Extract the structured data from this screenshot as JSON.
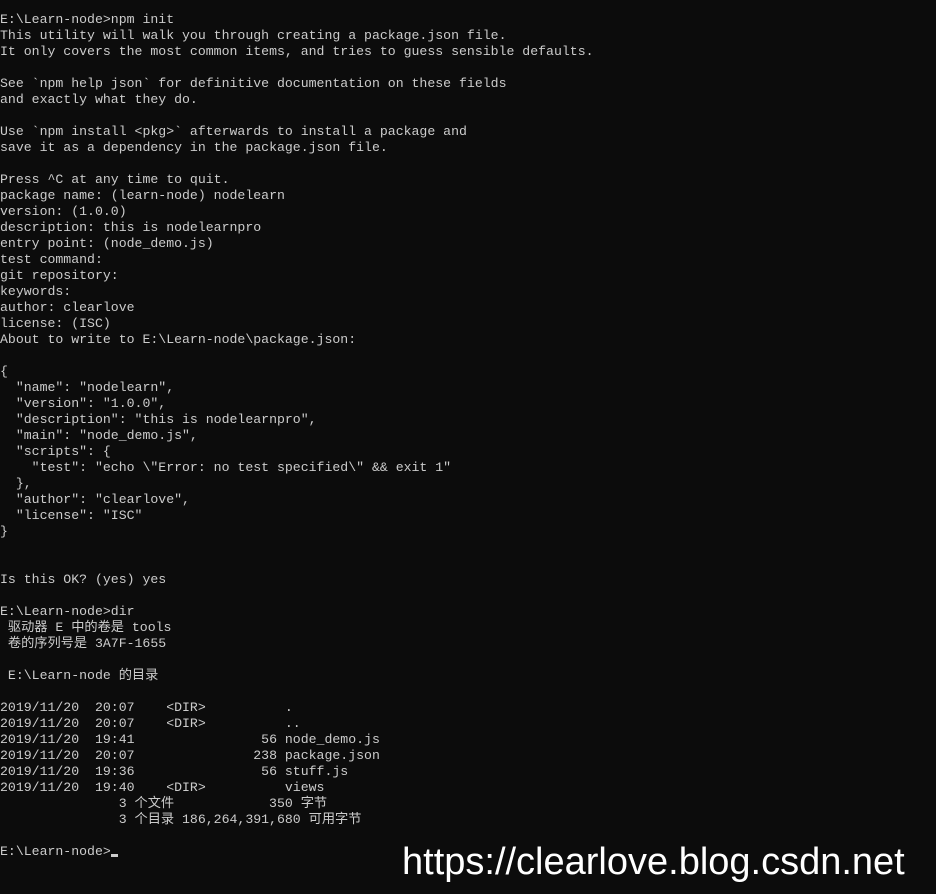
{
  "terminal": {
    "background": "#0c0c0c",
    "foreground": "#cccccc",
    "lines": [
      "E:\\Learn-node>npm init",
      "This utility will walk you through creating a package.json file.",
      "It only covers the most common items, and tries to guess sensible defaults.",
      "",
      "See `npm help json` for definitive documentation on these fields",
      "and exactly what they do.",
      "",
      "Use `npm install <pkg>` afterwards to install a package and",
      "save it as a dependency in the package.json file.",
      "",
      "Press ^C at any time to quit.",
      "package name: (learn-node) nodelearn",
      "version: (1.0.0)",
      "description: this is nodelearnpro",
      "entry point: (node_demo.js)",
      "test command:",
      "git repository:",
      "keywords:",
      "author: clearlove",
      "license: (ISC)",
      "About to write to E:\\Learn-node\\package.json:",
      "",
      "{",
      "  \"name\": \"nodelearn\",",
      "  \"version\": \"1.0.0\",",
      "  \"description\": \"this is nodelearnpro\",",
      "  \"main\": \"node_demo.js\",",
      "  \"scripts\": {",
      "    \"test\": \"echo \\\"Error: no test specified\\\" && exit 1\"",
      "  },",
      "  \"author\": \"clearlove\",",
      "  \"license\": \"ISC\"",
      "}",
      "",
      "",
      "Is this OK? (yes) yes",
      "",
      "E:\\Learn-node>dir",
      " 驱动器 E 中的卷是 tools",
      " 卷的序列号是 3A7F-1655",
      "",
      " E:\\Learn-node 的目录",
      "",
      "2019/11/20  20:07    <DIR>          .",
      "2019/11/20  20:07    <DIR>          ..",
      "2019/11/20  19:41                56 node_demo.js",
      "2019/11/20  20:07               238 package.json",
      "2019/11/20  19:36                56 stuff.js",
      "2019/11/20  19:40    <DIR>          views",
      "               3 个文件            350 字节",
      "               3 个目录 186,264,391,680 可用字节",
      ""
    ],
    "prompt": "E:\\Learn-node>"
  },
  "watermark": "https://clearlove.blog.csdn.net"
}
